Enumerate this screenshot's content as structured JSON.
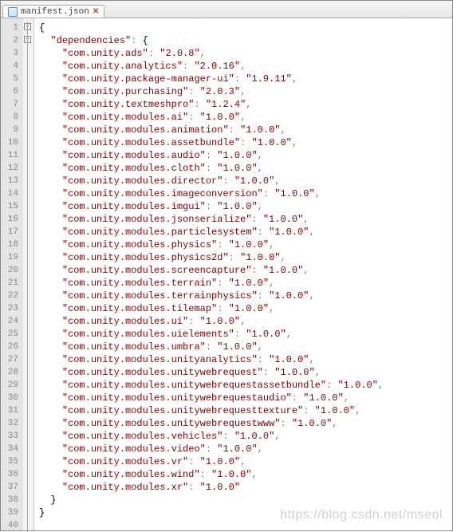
{
  "tab": {
    "filename": "manifest.json",
    "close_glyph": "✕"
  },
  "json": {
    "root_key": "\"dependencies\"",
    "brace_open": "{",
    "brace_close": "}",
    "colon": ": ",
    "comma": ",",
    "entries": [
      {
        "k": "\"com.unity.ads\"",
        "v": "\"2.0.8\""
      },
      {
        "k": "\"com.unity.analytics\"",
        "v": "\"2.0.16\""
      },
      {
        "k": "\"com.unity.package-manager-ui\"",
        "v": "\"1.9.11\""
      },
      {
        "k": "\"com.unity.purchasing\"",
        "v": "\"2.0.3\""
      },
      {
        "k": "\"com.unity.textmeshpro\"",
        "v": "\"1.2.4\""
      },
      {
        "k": "\"com.unity.modules.ai\"",
        "v": "\"1.0.0\""
      },
      {
        "k": "\"com.unity.modules.animation\"",
        "v": "\"1.0.0\""
      },
      {
        "k": "\"com.unity.modules.assetbundle\"",
        "v": "\"1.0.0\""
      },
      {
        "k": "\"com.unity.modules.audio\"",
        "v": "\"1.0.0\""
      },
      {
        "k": "\"com.unity.modules.cloth\"",
        "v": "\"1.0.0\""
      },
      {
        "k": "\"com.unity.modules.director\"",
        "v": "\"1.0.0\""
      },
      {
        "k": "\"com.unity.modules.imageconversion\"",
        "v": "\"1.0.0\""
      },
      {
        "k": "\"com.unity.modules.imgui\"",
        "v": "\"1.0.0\""
      },
      {
        "k": "\"com.unity.modules.jsonserialize\"",
        "v": "\"1.0.0\""
      },
      {
        "k": "\"com.unity.modules.particlesystem\"",
        "v": "\"1.0.0\""
      },
      {
        "k": "\"com.unity.modules.physics\"",
        "v": "\"1.0.0\""
      },
      {
        "k": "\"com.unity.modules.physics2d\"",
        "v": "\"1.0.0\""
      },
      {
        "k": "\"com.unity.modules.screencapture\"",
        "v": "\"1.0.0\""
      },
      {
        "k": "\"com.unity.modules.terrain\"",
        "v": "\"1.0.0\""
      },
      {
        "k": "\"com.unity.modules.terrainphysics\"",
        "v": "\"1.0.0\""
      },
      {
        "k": "\"com.unity.modules.tilemap\"",
        "v": "\"1.0.0\""
      },
      {
        "k": "\"com.unity.modules.ui\"",
        "v": "\"1.0.0\""
      },
      {
        "k": "\"com.unity.modules.uielements\"",
        "v": "\"1.0.0\""
      },
      {
        "k": "\"com.unity.modules.umbra\"",
        "v": "\"1.0.0\""
      },
      {
        "k": "\"com.unity.modules.unityanalytics\"",
        "v": "\"1.0.0\""
      },
      {
        "k": "\"com.unity.modules.unitywebrequest\"",
        "v": "\"1.0.0\""
      },
      {
        "k": "\"com.unity.modules.unitywebrequestassetbundle\"",
        "v": "\"1.0.0\""
      },
      {
        "k": "\"com.unity.modules.unitywebrequestaudio\"",
        "v": "\"1.0.0\""
      },
      {
        "k": "\"com.unity.modules.unitywebrequesttexture\"",
        "v": "\"1.0.0\""
      },
      {
        "k": "\"com.unity.modules.unitywebrequestwww\"",
        "v": "\"1.0.0\""
      },
      {
        "k": "\"com.unity.modules.vehicles\"",
        "v": "\"1.0.0\""
      },
      {
        "k": "\"com.unity.modules.video\"",
        "v": "\"1.0.0\""
      },
      {
        "k": "\"com.unity.modules.vr\"",
        "v": "\"1.0.0\""
      },
      {
        "k": "\"com.unity.modules.wind\"",
        "v": "\"1.0.0\""
      },
      {
        "k": "\"com.unity.modules.xr\"",
        "v": "\"1.0.0\""
      }
    ]
  },
  "watermark": "https://blog.csdn.net/mseol"
}
